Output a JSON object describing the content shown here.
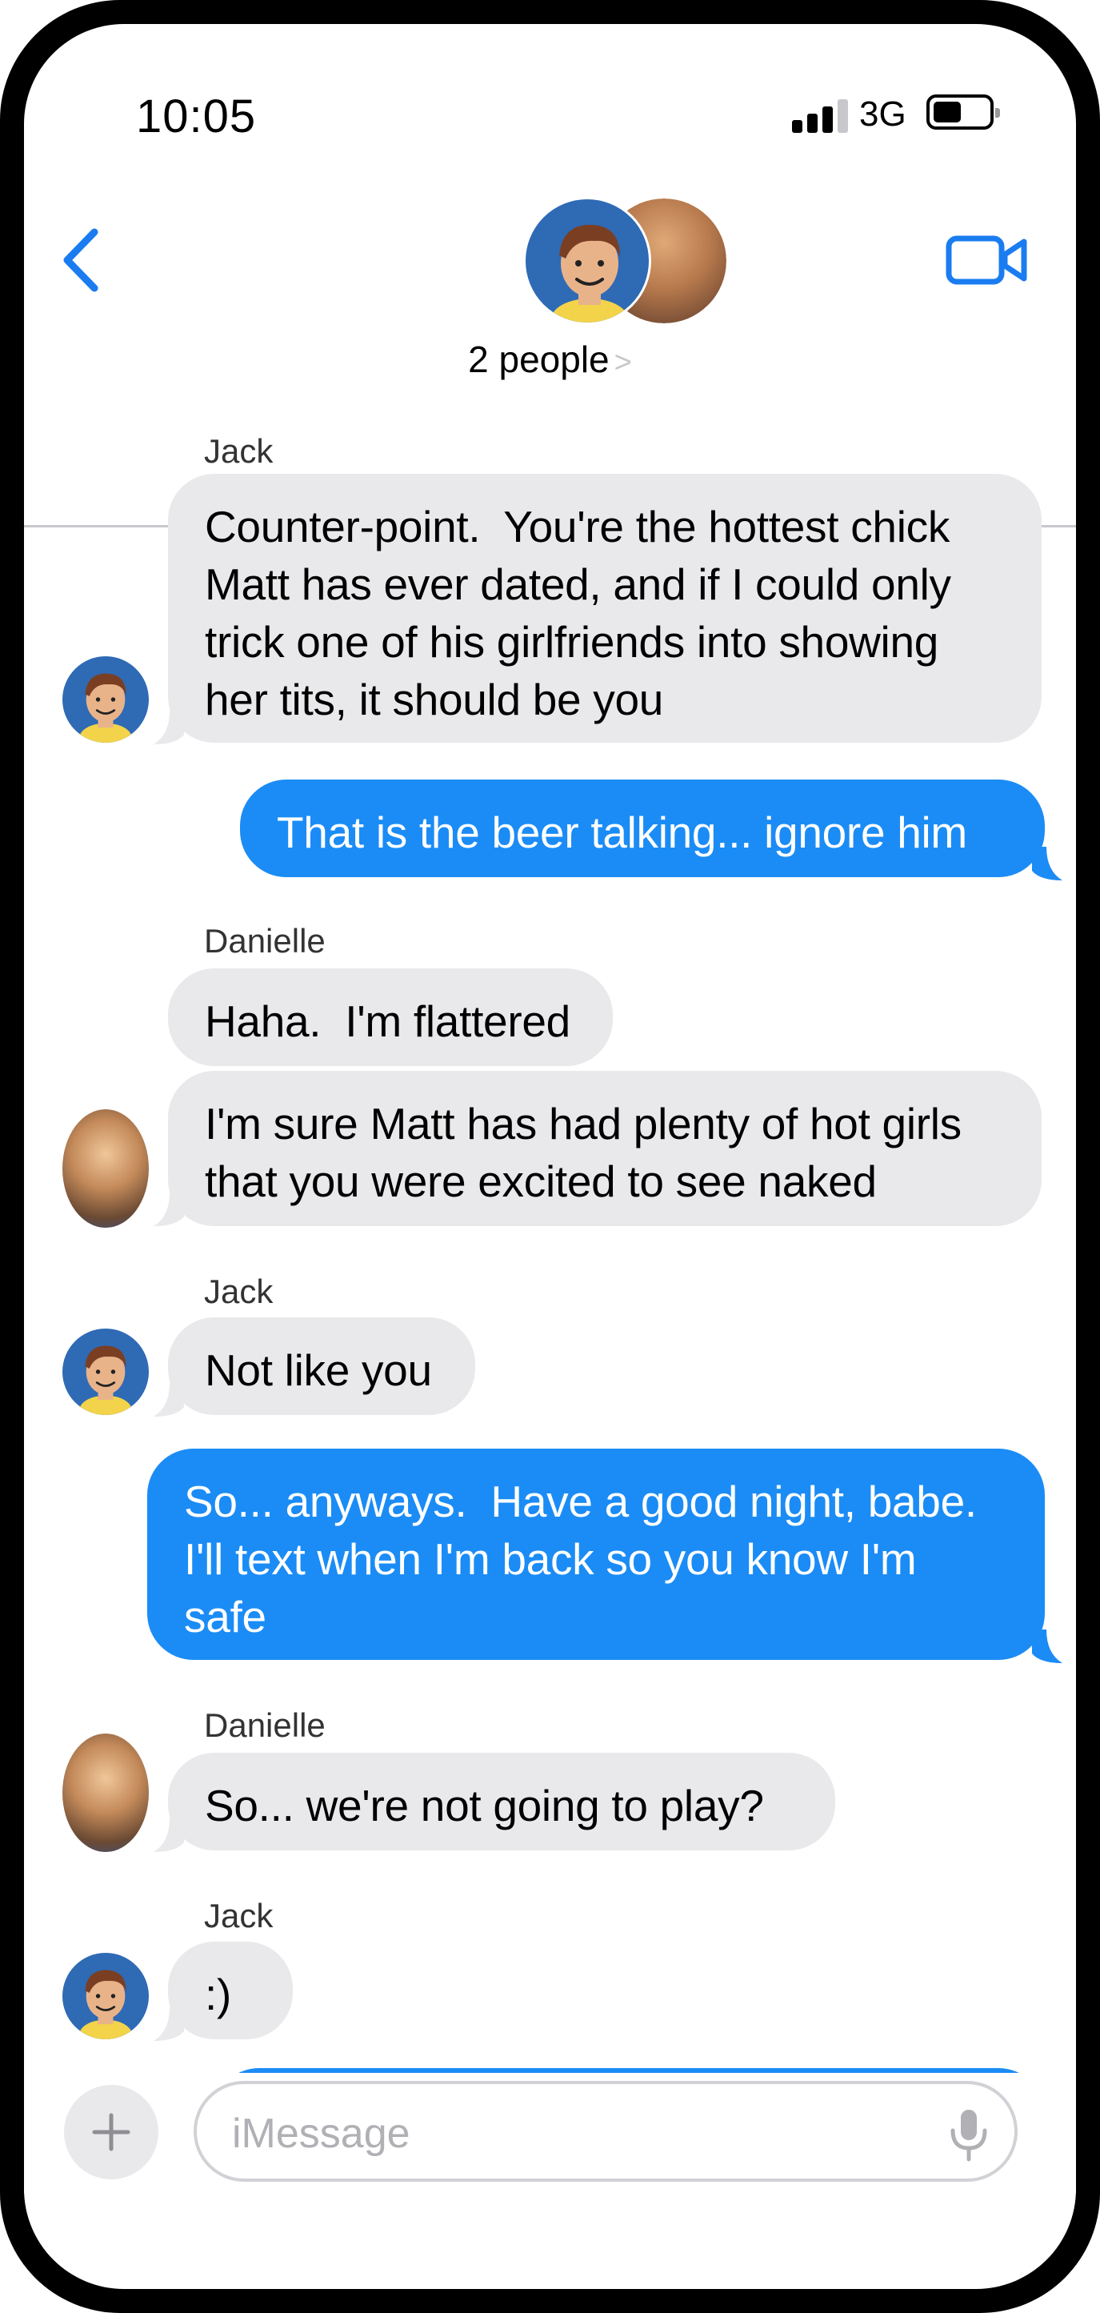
{
  "status_bar": {
    "time": "10:05",
    "network": "3G"
  },
  "header": {
    "people_label": "2 people",
    "chevron": ">"
  },
  "messages": [
    {
      "sender": "Jack",
      "direction": "in",
      "text": "Counter-point.  You're the hottest chick\nMatt has ever dated, and if I could only\ntrick one of his girlfriends into showing\nher tits, it should be you"
    },
    {
      "direction": "out",
      "text": "That is the beer talking... ignore him"
    },
    {
      "sender": "Danielle",
      "direction": "in",
      "text": "Haha.  I'm flattered"
    },
    {
      "direction": "in",
      "text": "I'm sure Matt has had plenty of hot girls\nthat you were excited to see naked"
    },
    {
      "sender": "Jack",
      "direction": "in",
      "text": "Not like you"
    },
    {
      "direction": "out",
      "text": "So... anyways.  Have a good night, babe.\nI'll text when I'm back so you know I'm\nsafe"
    },
    {
      "sender": "Danielle",
      "direction": "in",
      "text": "So... we're not going to play?"
    },
    {
      "sender": "Jack",
      "direction": "in",
      "text": ":)"
    }
  ],
  "input": {
    "placeholder": "iMessage"
  },
  "colors": {
    "accent": "#1b8cf5",
    "incoming": "#e9e9eb",
    "link": "#1a7cf0"
  }
}
